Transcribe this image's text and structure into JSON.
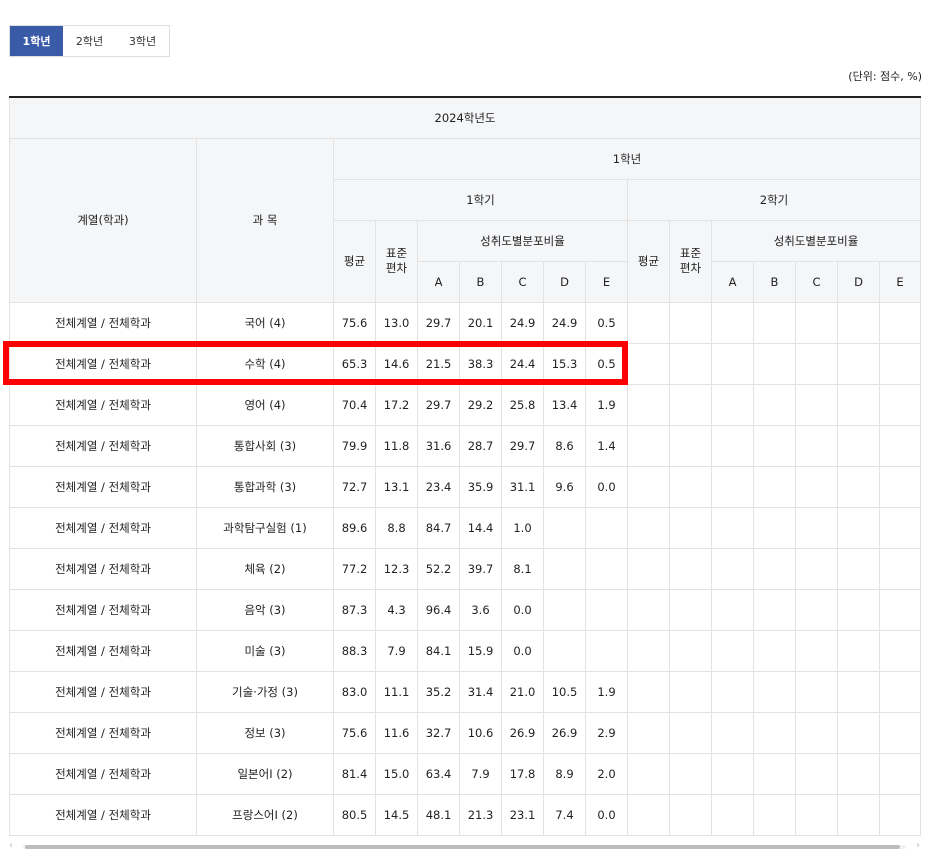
{
  "tabs": [
    {
      "label": "1학년",
      "active": true
    },
    {
      "label": "2학년",
      "active": false
    },
    {
      "label": "3학년",
      "active": false
    }
  ],
  "unit_label": "(단위: 점수, %)",
  "table": {
    "year_header": "2024학년도",
    "col_dept": "계열(학과)",
    "col_subject": "과 목",
    "grade_header": "1학년",
    "semester1": "1학기",
    "semester2": "2학기",
    "avg": "평균",
    "stddev_line1": "표준",
    "stddev_line2": "편차",
    "dist": "성취도별분포비율",
    "grades": [
      "A",
      "B",
      "C",
      "D",
      "E"
    ],
    "rows": [
      {
        "dept": "전체계열 / 전체학과",
        "subject": "국어 (4)",
        "avg": "75.6",
        "sd": "13.0",
        "a": "29.7",
        "b": "20.1",
        "c": "24.9",
        "d": "24.9",
        "e": "0.5"
      },
      {
        "dept": "전체계열 / 전체학과",
        "subject": "수학 (4)",
        "avg": "65.3",
        "sd": "14.6",
        "a": "21.5",
        "b": "38.3",
        "c": "24.4",
        "d": "15.3",
        "e": "0.5"
      },
      {
        "dept": "전체계열 / 전체학과",
        "subject": "영어 (4)",
        "avg": "70.4",
        "sd": "17.2",
        "a": "29.7",
        "b": "29.2",
        "c": "25.8",
        "d": "13.4",
        "e": "1.9"
      },
      {
        "dept": "전체계열 / 전체학과",
        "subject": "통합사회 (3)",
        "avg": "79.9",
        "sd": "11.8",
        "a": "31.6",
        "b": "28.7",
        "c": "29.7",
        "d": "8.6",
        "e": "1.4"
      },
      {
        "dept": "전체계열 / 전체학과",
        "subject": "통합과학 (3)",
        "avg": "72.7",
        "sd": "13.1",
        "a": "23.4",
        "b": "35.9",
        "c": "31.1",
        "d": "9.6",
        "e": "0.0"
      },
      {
        "dept": "전체계열 / 전체학과",
        "subject": "과학탐구실험 (1)",
        "avg": "89.6",
        "sd": "8.8",
        "a": "84.7",
        "b": "14.4",
        "c": "1.0",
        "d": "",
        "e": ""
      },
      {
        "dept": "전체계열 / 전체학과",
        "subject": "체육 (2)",
        "avg": "77.2",
        "sd": "12.3",
        "a": "52.2",
        "b": "39.7",
        "c": "8.1",
        "d": "",
        "e": ""
      },
      {
        "dept": "전체계열 / 전체학과",
        "subject": "음악 (3)",
        "avg": "87.3",
        "sd": "4.3",
        "a": "96.4",
        "b": "3.6",
        "c": "0.0",
        "d": "",
        "e": ""
      },
      {
        "dept": "전체계열 / 전체학과",
        "subject": "미술 (3)",
        "avg": "88.3",
        "sd": "7.9",
        "a": "84.1",
        "b": "15.9",
        "c": "0.0",
        "d": "",
        "e": ""
      },
      {
        "dept": "전체계열 / 전체학과",
        "subject": "기술·가정 (3)",
        "avg": "83.0",
        "sd": "11.1",
        "a": "35.2",
        "b": "31.4",
        "c": "21.0",
        "d": "10.5",
        "e": "1.9"
      },
      {
        "dept": "전체계열 / 전체학과",
        "subject": "정보 (3)",
        "avg": "75.6",
        "sd": "11.6",
        "a": "32.7",
        "b": "10.6",
        "c": "26.9",
        "d": "26.9",
        "e": "2.9"
      },
      {
        "dept": "전체계열 / 전체학과",
        "subject": "일본어Ⅰ (2)",
        "avg": "81.4",
        "sd": "15.0",
        "a": "63.4",
        "b": "7.9",
        "c": "17.8",
        "d": "8.9",
        "e": "2.0"
      },
      {
        "dept": "전체계열 / 전체학과",
        "subject": "프랑스어Ⅰ (2)",
        "avg": "80.5",
        "sd": "14.5",
        "a": "48.1",
        "b": "21.3",
        "c": "23.1",
        "d": "7.4",
        "e": "0.0"
      }
    ]
  },
  "highlight_color": "#ff0000",
  "active_tab_color": "#3a5ba8"
}
